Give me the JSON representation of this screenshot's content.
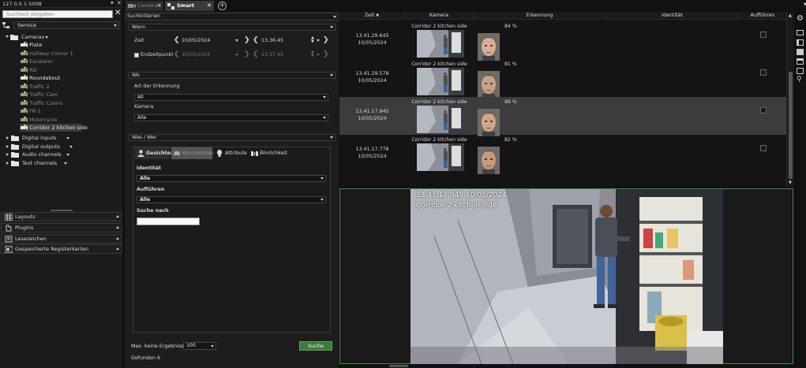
{
  "server": "127.0.0.1:5008",
  "left": {
    "search_placeholder": "Suchtext eingeben",
    "view_select": "Service",
    "tree": {
      "root": "Cameras",
      "items": [
        "Plate",
        "Hallway Corner 1",
        "Escalator",
        "RD",
        "Roundabout",
        "Traffic 2",
        "Traffic Cam",
        "Traffic Colors",
        "FR-1",
        "Motorcycle",
        "Corridor 2 kitchen side"
      ],
      "groups": [
        "Digital inputs",
        "Digital outputs",
        "Audio channels",
        "Text channels"
      ]
    },
    "panels": [
      "Layouts",
      "Plugins",
      "Lesezeichen",
      "Gespeicherte Registerkarten"
    ]
  },
  "tabs": [
    "Cameras",
    "Smart Search"
  ],
  "criteria": {
    "title": "Suchkriterien",
    "when": {
      "title": "Wann",
      "zeit_label": "Zeit",
      "zeit_date": "10/05/2024",
      "zeit_time": "13.36.45",
      "end_label": "Endzeitpunkt",
      "end_date": "10/05/2024",
      "end_time": "13.37.45"
    },
    "where": {
      "title": "Wo",
      "type_label": "Art der Erkennung",
      "type_value": "All",
      "camera_label": "Kamera",
      "camera_value": "Alle"
    },
    "what": {
      "title": "Was / Wer",
      "tabs": [
        "Gesichter",
        "Kennzeichen",
        "Attribute",
        "Ähnlichkeit"
      ],
      "identity_label": "Identität",
      "identity_value": "Alle",
      "list_label": "Aufführen",
      "list_value": "Alle",
      "search_label": "Suche nach",
      "search_value": ""
    },
    "max_label": "Max. keine Ergebnisse",
    "max_value": "100",
    "search_button": "Suche",
    "found": "Gefunden 6"
  },
  "results": {
    "columns": [
      "Zeit",
      "Kamera",
      "Erkennung",
      "Identität",
      "Aufführen"
    ],
    "rows": [
      {
        "time": "13.41.29.645",
        "date": "10/05/2024",
        "camera": "Corridor 2 kitchen side",
        "score": "84 %",
        "selected": false
      },
      {
        "time": "13.41.29.578",
        "date": "10/05/2024",
        "camera": "Corridor 2 kitchen side",
        "score": "81 %",
        "selected": false
      },
      {
        "time": "13.41.17.945",
        "date": "10/05/2024",
        "camera": "Corridor 2 kitchen side",
        "score": "88 %",
        "selected": true
      },
      {
        "time": "13.41.17.778",
        "date": "10/05/2024",
        "camera": "Corridor 2 kitchen side",
        "score": "82 %",
        "selected": false
      }
    ]
  },
  "video": {
    "timestamp": "13.41.17.945  10/05/2024",
    "camera": "Corridor 2 kitchen side"
  },
  "colors": {
    "accent_green": "#3d8c3d",
    "folder": "#f2c744",
    "selected_row": "#3c3c3c"
  }
}
